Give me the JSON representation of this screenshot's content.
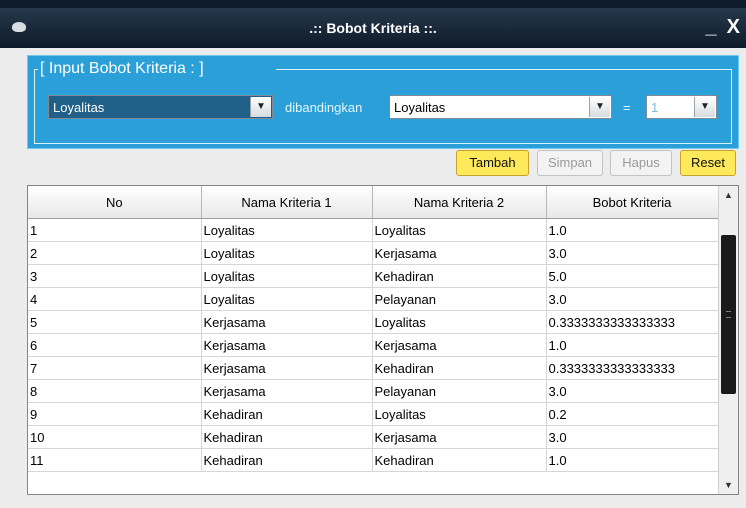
{
  "window": {
    "title": ".:: Bobot Kriteria ::.",
    "minimize": "_",
    "close": "X"
  },
  "panel": {
    "legend": "[ Input Bobot Kriteria : ]",
    "criteria1": "Loyalitas",
    "compare_label": "dibandingkan",
    "criteria2": "Loyalitas",
    "equals": "=",
    "weight": "1"
  },
  "buttons": {
    "tambah": "Tambah",
    "simpan": "Simpan",
    "hapus": "Hapus",
    "reset": "Reset"
  },
  "table": {
    "headers": [
      "No",
      "Nama Kriteria 1",
      "Nama Kriteria 2",
      "Bobot Kriteria"
    ],
    "rows": [
      [
        "1",
        "Loyalitas",
        "Loyalitas",
        "1.0"
      ],
      [
        "2",
        "Loyalitas",
        "Kerjasama",
        "3.0"
      ],
      [
        "3",
        "Loyalitas",
        "Kehadiran",
        "5.0"
      ],
      [
        "4",
        "Loyalitas",
        "Pelayanan",
        "3.0"
      ],
      [
        "5",
        "Kerjasama",
        "Loyalitas",
        "0.3333333333333333"
      ],
      [
        "6",
        "Kerjasama",
        "Kerjasama",
        "1.0"
      ],
      [
        "7",
        "Kerjasama",
        "Kehadiran",
        "0.3333333333333333"
      ],
      [
        "8",
        "Kerjasama",
        "Pelayanan",
        "3.0"
      ],
      [
        "9",
        "Kehadiran",
        "Loyalitas",
        "0.2"
      ],
      [
        "10",
        "Kehadiran",
        "Kerjasama",
        "3.0"
      ],
      [
        "11",
        "Kehadiran",
        "Kehadiran",
        "1.0"
      ]
    ]
  },
  "icons": {
    "app": "app-icon",
    "dropdown": "chevron-down-icon",
    "scroll_up": "chevron-up-icon",
    "scroll_down": "chevron-down-icon",
    "scroll_grip": "grip-icon"
  },
  "colors": {
    "panel": "#2a9fd8",
    "titlebar": "#1a2a3b",
    "active_button": "#fde95a"
  }
}
